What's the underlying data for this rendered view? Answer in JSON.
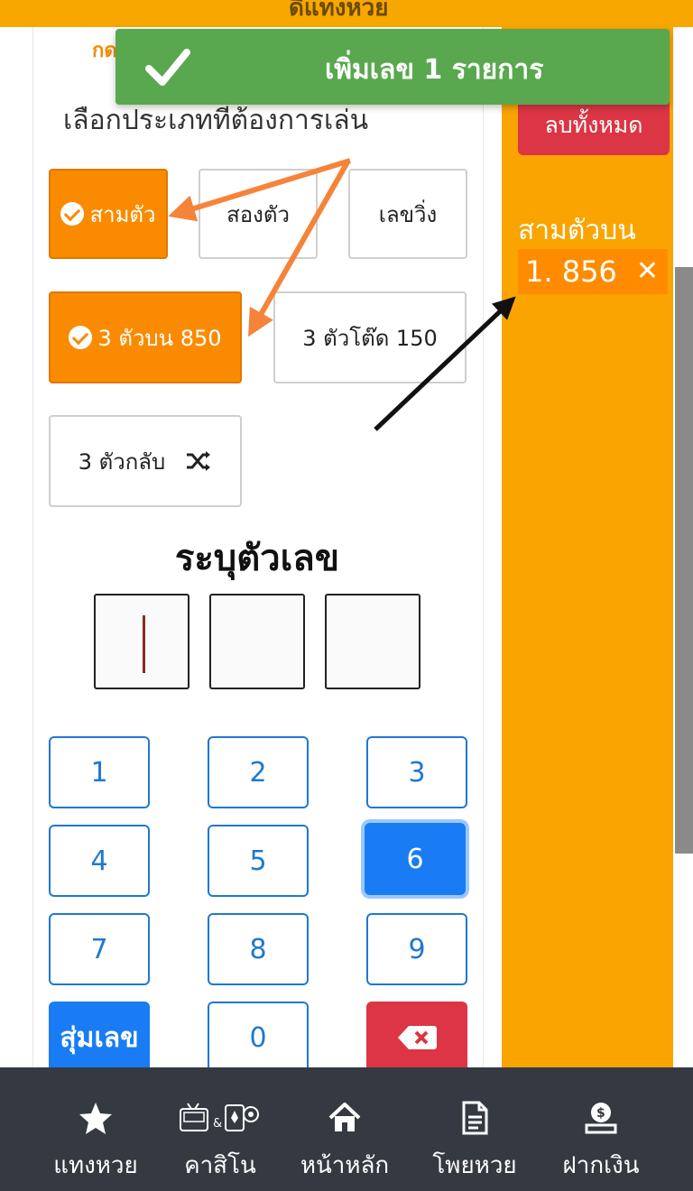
{
  "header": {
    "title_fragment": "ดีแทงหวย",
    "tab_fragment": "กด"
  },
  "toast": {
    "message": "เพิ่มเลข 1 รายการ"
  },
  "bet_type": {
    "heading": "เลือกประเภทที่ต้องการเล่น",
    "types": [
      "สามตัว",
      "สองตัว",
      "เลขวิ่ง"
    ],
    "options": [
      "3 ตัวบน 850",
      "3 ตัวโต๊ด 150",
      "3 ตัวกลับ"
    ]
  },
  "number_entry": {
    "heading": "ระบุตัวเลข"
  },
  "keypad": {
    "keys": [
      "1",
      "2",
      "3",
      "4",
      "5",
      "6",
      "7",
      "8",
      "9"
    ],
    "zero": "0",
    "random_label": "สุ่มเลข"
  },
  "bet_list": {
    "clear_label": "ลบทั้งหมด",
    "title": "สามตัวบน",
    "items": [
      {
        "number": "1. 856",
        "remove": "✕"
      }
    ]
  },
  "bottom_nav": {
    "items": [
      {
        "label": "แทงหวย",
        "icon": "star-icon"
      },
      {
        "label": "คาสิโน",
        "icon": "casino-icon"
      },
      {
        "label": "หน้าหลัก",
        "icon": "home-icon"
      },
      {
        "label": "โพยหวย",
        "icon": "document-icon"
      },
      {
        "label": "ฝากเงิน",
        "icon": "deposit-icon"
      }
    ]
  },
  "colors": {
    "orange": "#fa8b00",
    "green": "#59a84f",
    "blue": "#1f78d1",
    "red": "#dc3545",
    "nav_bg": "#353a42"
  }
}
